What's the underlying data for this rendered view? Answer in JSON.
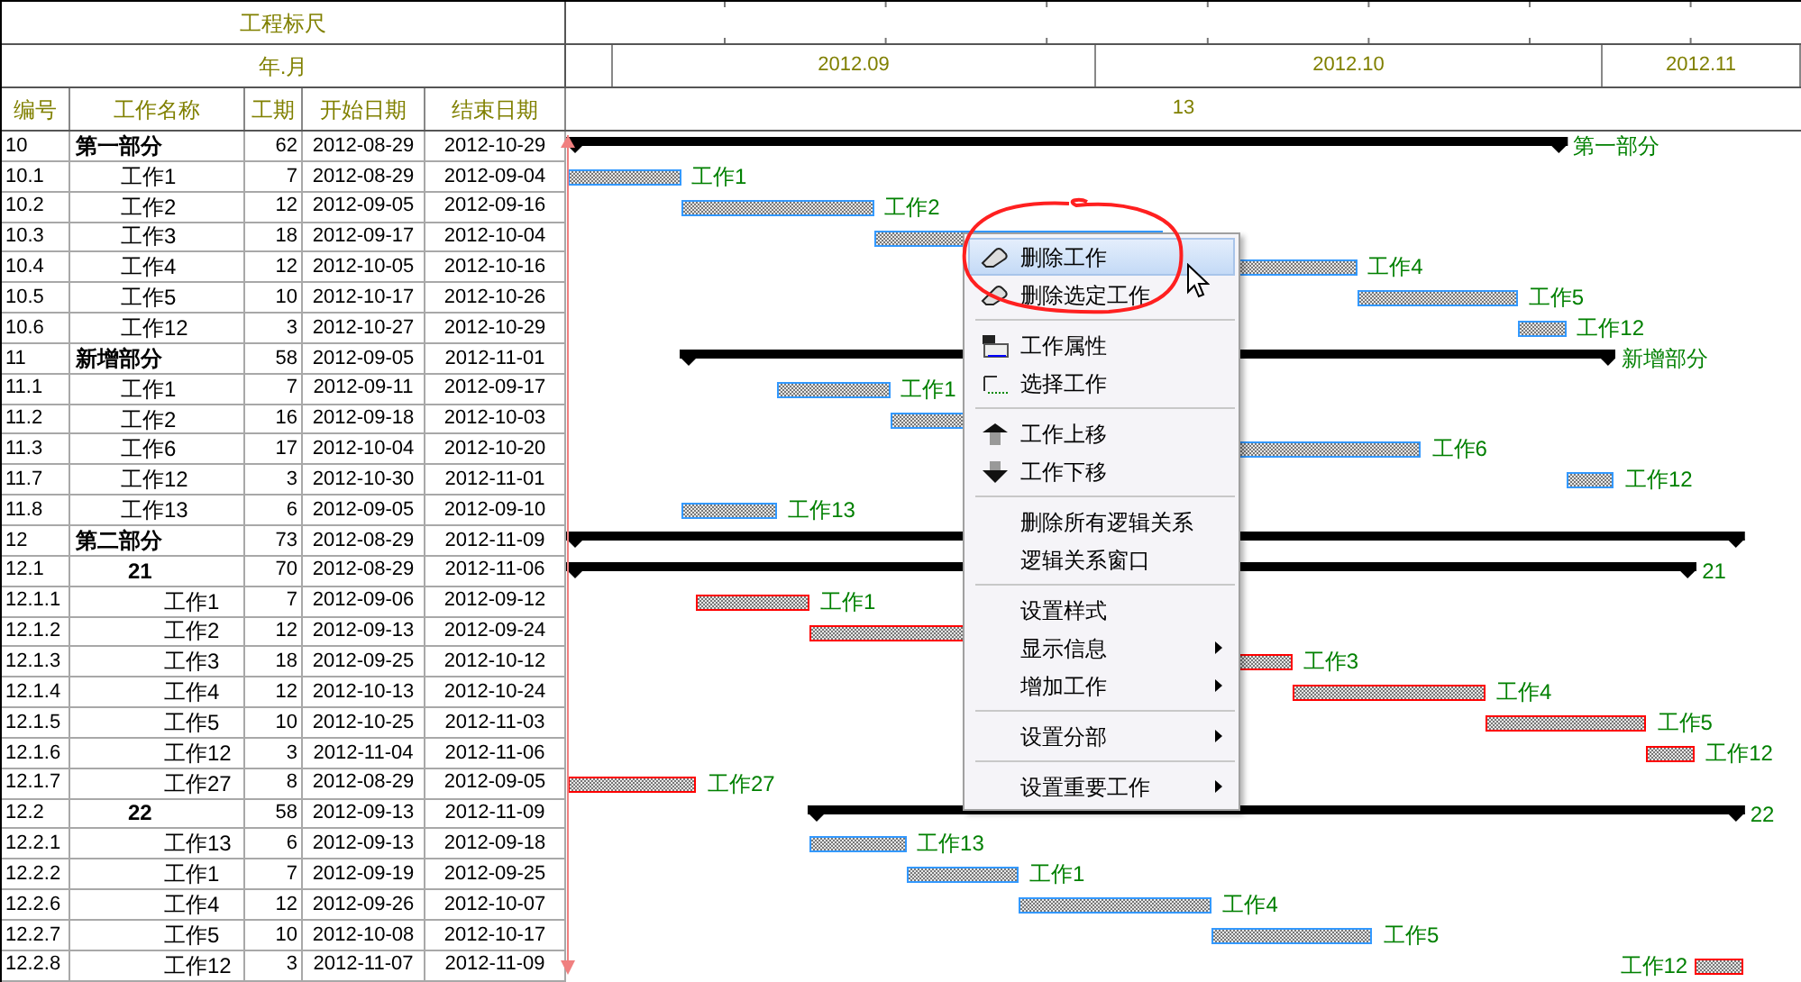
{
  "ruler": {
    "title": "工程标尺",
    "unit": "年.月"
  },
  "columns": [
    "编号",
    "工作名称",
    "工期",
    "开始日期",
    "结束日期"
  ],
  "timeline": {
    "months": [
      "2012.09",
      "2012.10",
      "2012.11"
    ],
    "span": "13"
  },
  "rows": [
    {
      "code": "10",
      "name": "第一部分",
      "duration": "62",
      "start": "2012-08-29",
      "end": "2012-10-29",
      "kind": "group",
      "bar": {
        "label": "第一部分"
      },
      "children": [
        {
          "code": "10.1",
          "name": "工作1",
          "duration": "7",
          "start": "2012-08-29",
          "end": "2012-09-04",
          "kind": "task",
          "bar": {
            "label": "工作1",
            "color": "#3399ff"
          }
        },
        {
          "code": "10.2",
          "name": "工作2",
          "duration": "12",
          "start": "2012-09-05",
          "end": "2012-09-16",
          "kind": "task",
          "bar": {
            "label": "工作2",
            "color": "#3399ff"
          }
        },
        {
          "code": "10.3",
          "name": "工作3",
          "duration": "18",
          "start": "2012-09-17",
          "end": "2012-10-04",
          "kind": "task",
          "bar": {
            "color": "#3399ff"
          }
        },
        {
          "code": "10.4",
          "name": "工作4",
          "duration": "12",
          "start": "2012-10-05",
          "end": "2012-10-16",
          "kind": "task",
          "bar": {
            "label": "工作4",
            "color": "#3399ff"
          }
        },
        {
          "code": "10.5",
          "name": "工作5",
          "duration": "10",
          "start": "2012-10-17",
          "end": "2012-10-26",
          "kind": "task",
          "bar": {
            "label": "工作5",
            "color": "#3399ff"
          }
        },
        {
          "code": "10.6",
          "name": "工作12",
          "duration": "3",
          "start": "2012-10-27",
          "end": "2012-10-29",
          "kind": "task",
          "bar": {
            "label": "工作12",
            "color": "#3399ff"
          }
        }
      ]
    },
    {
      "code": "11",
      "name": "新增部分",
      "duration": "58",
      "start": "2012-09-05",
      "end": "2012-11-01",
      "kind": "group",
      "bar": {
        "label": "新增部分"
      },
      "children": [
        {
          "code": "11.1",
          "name": "工作1",
          "duration": "7",
          "start": "2012-09-11",
          "end": "2012-09-17",
          "kind": "task",
          "bar": {
            "label": "工作1",
            "color": "#3399ff"
          }
        },
        {
          "code": "11.2",
          "name": "工作2",
          "duration": "16",
          "start": "2012-09-18",
          "end": "2012-10-03",
          "kind": "task",
          "bar": {
            "color": "#3399ff"
          }
        },
        {
          "code": "11.3",
          "name": "工作6",
          "duration": "17",
          "start": "2012-10-04",
          "end": "2012-10-20",
          "kind": "task",
          "bar": {
            "label": "工作6",
            "color": "#3399ff"
          }
        },
        {
          "code": "11.7",
          "name": "工作12",
          "duration": "3",
          "start": "2012-10-30",
          "end": "2012-11-01",
          "kind": "task",
          "bar": {
            "label": "工作12",
            "color": "#3399ff"
          }
        },
        {
          "code": "11.8",
          "name": "工作13",
          "duration": "6",
          "start": "2012-09-05",
          "end": "2012-09-10",
          "kind": "task",
          "bar": {
            "label": "工作13",
            "color": "#3399ff"
          }
        }
      ]
    },
    {
      "code": "12",
      "name": "第二部分",
      "duration": "73",
      "start": "2012-08-29",
      "end": "2012-11-09",
      "kind": "group",
      "bar": {},
      "children": [
        {
          "code": "12.1",
          "name": "21",
          "duration": "70",
          "start": "2012-08-29",
          "end": "2012-11-06",
          "kind": "group",
          "bar": {
            "label": "21"
          },
          "children": [
            {
              "code": "12.1.1",
              "name": "工作1",
              "duration": "7",
              "start": "2012-09-06",
              "end": "2012-09-12",
              "kind": "task",
              "bar": {
                "label": "工作1",
                "color": "#ff0000"
              }
            },
            {
              "code": "12.1.2",
              "name": "工作2",
              "duration": "12",
              "start": "2012-09-13",
              "end": "2012-09-24",
              "kind": "task",
              "bar": {
                "color": "#ff0000"
              }
            },
            {
              "code": "12.1.3",
              "name": "工作3",
              "duration": "18",
              "start": "2012-09-25",
              "end": "2012-10-12",
              "kind": "task",
              "bar": {
                "label": "工作3",
                "color": "#ff0000"
              }
            },
            {
              "code": "12.1.4",
              "name": "工作4",
              "duration": "12",
              "start": "2012-10-13",
              "end": "2012-10-24",
              "kind": "task",
              "bar": {
                "label": "工作4",
                "color": "#ff0000"
              }
            },
            {
              "code": "12.1.5",
              "name": "工作5",
              "duration": "10",
              "start": "2012-10-25",
              "end": "2012-11-03",
              "kind": "task",
              "bar": {
                "label": "工作5",
                "color": "#ff0000"
              }
            },
            {
              "code": "12.1.6",
              "name": "工作12",
              "duration": "3",
              "start": "2012-11-04",
              "end": "2012-11-06",
              "kind": "task",
              "bar": {
                "label": "工作12",
                "color": "#ff0000"
              }
            },
            {
              "code": "12.1.7",
              "name": "工作27",
              "duration": "8",
              "start": "2012-08-29",
              "end": "2012-09-05",
              "kind": "task",
              "bar": {
                "label": "工作27",
                "color": "#ff0000"
              }
            }
          ]
        },
        {
          "code": "12.2",
          "name": "22",
          "duration": "58",
          "start": "2012-09-13",
          "end": "2012-11-09",
          "kind": "group",
          "bar": {
            "label": "22"
          },
          "children": [
            {
              "code": "12.2.1",
              "name": "工作13",
              "duration": "6",
              "start": "2012-09-13",
              "end": "2012-09-18",
              "kind": "task",
              "bar": {
                "label": "工作13",
                "color": "#3399ff"
              }
            },
            {
              "code": "12.2.2",
              "name": "工作1",
              "duration": "7",
              "start": "2012-09-19",
              "end": "2012-09-25",
              "kind": "task",
              "bar": {
                "label": "工作1",
                "color": "#3399ff"
              }
            },
            {
              "code": "12.2.6",
              "name": "工作4",
              "duration": "12",
              "start": "2012-09-26",
              "end": "2012-10-07",
              "kind": "task",
              "bar": {
                "label": "工作4",
                "color": "#3399ff"
              }
            },
            {
              "code": "12.2.7",
              "name": "工作5",
              "duration": "10",
              "start": "2012-10-08",
              "end": "2012-10-17",
              "kind": "task",
              "bar": {
                "label": "工作5",
                "color": "#3399ff"
              }
            },
            {
              "code": "12.2.8",
              "name": "工作12",
              "duration": "3",
              "start": "2012-11-07",
              "end": "2012-11-09",
              "kind": "task",
              "bar": {
                "label": "工作12",
                "color": "#ff0000"
              }
            }
          ]
        }
      ]
    }
  ],
  "context_menu": {
    "items": [
      {
        "kind": "eraser",
        "label": "删除工作",
        "submenu": false,
        "selected": true
      },
      {
        "kind": "eraser",
        "label": "删除选定工作",
        "submenu": false,
        "selected": false
      },
      {
        "kind": "separator"
      },
      {
        "kind": "properties",
        "label": "工作属性",
        "submenu": false,
        "selected": false
      },
      {
        "kind": "select",
        "label": "选择工作",
        "submenu": false,
        "selected": false
      },
      {
        "kind": "separator"
      },
      {
        "kind": "moveup",
        "label": "工作上移",
        "submenu": false,
        "selected": false
      },
      {
        "kind": "movedown",
        "label": "工作下移",
        "submenu": false,
        "selected": false
      },
      {
        "kind": "separator"
      },
      {
        "kind": "item",
        "label": "删除所有逻辑关系",
        "submenu": false,
        "selected": false
      },
      {
        "kind": "item",
        "label": "逻辑关系窗口",
        "submenu": false,
        "selected": false
      },
      {
        "kind": "separator"
      },
      {
        "kind": "item",
        "label": "设置样式",
        "submenu": false,
        "selected": false
      },
      {
        "kind": "item",
        "label": "显示信息",
        "submenu": true,
        "selected": false
      },
      {
        "kind": "item",
        "label": "增加工作",
        "submenu": true,
        "selected": false
      },
      {
        "kind": "separator"
      },
      {
        "kind": "item",
        "label": "设置分部",
        "submenu": true,
        "selected": false
      },
      {
        "kind": "separator"
      },
      {
        "kind": "item",
        "label": "设置重要工作",
        "submenu": true,
        "selected": false
      }
    ]
  }
}
